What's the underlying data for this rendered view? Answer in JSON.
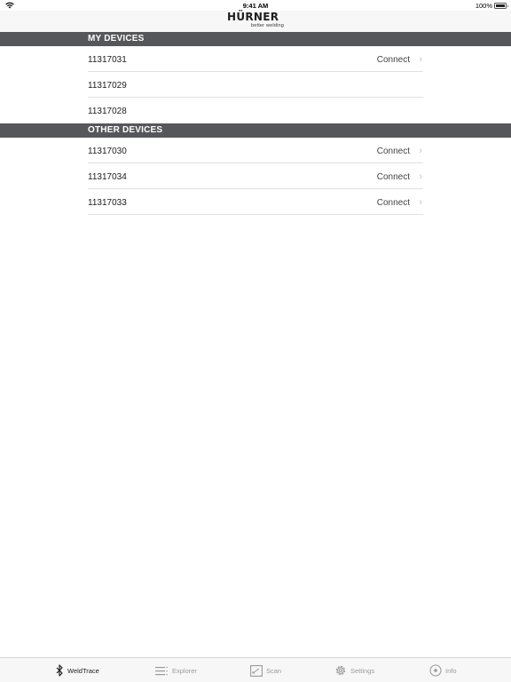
{
  "status_bar": {
    "time": "9:41 AM",
    "battery": "100%"
  },
  "header": {
    "brand": "HÜRNER",
    "tagline": "better welding"
  },
  "sections": {
    "my_devices": {
      "title": "MY DEVICES",
      "rows": [
        {
          "id": "11317031",
          "action": "Connect"
        },
        {
          "id": "11317029"
        },
        {
          "id": "11317028"
        }
      ]
    },
    "other_devices": {
      "title": "OTHER DEVICES",
      "rows": [
        {
          "id": "11317030",
          "action": "Connect"
        },
        {
          "id": "11317034",
          "action": "Connect"
        },
        {
          "id": "11317033",
          "action": "Connect"
        }
      ]
    }
  },
  "tabs": [
    {
      "label": "WeldTrace",
      "icon": "bluetooth-icon",
      "active": true
    },
    {
      "label": "Explorer",
      "icon": "list-icon",
      "active": false
    },
    {
      "label": "Scan",
      "icon": "scan-icon",
      "active": false
    },
    {
      "label": "Settings",
      "icon": "gear-icon",
      "active": false
    },
    {
      "label": "Info",
      "icon": "info-icon",
      "active": false
    }
  ]
}
